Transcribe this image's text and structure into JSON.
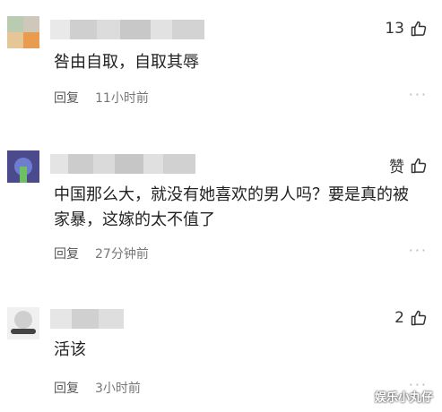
{
  "comments": [
    {
      "text": "咎由自取，自取其辱",
      "reply_label": "回复",
      "time": "11小时前",
      "like": "13",
      "more": "···"
    },
    {
      "text": "中国那么大，就没有她喜欢的男人吗？要是真的被家暴，这嫁的太不值了",
      "reply_label": "回复",
      "time": "27分钟前",
      "like": "赞",
      "more": "···"
    },
    {
      "text": "活该",
      "reply_label": "回复",
      "time": "3小时前",
      "like": "2",
      "more": "···"
    }
  ],
  "watermark": "娱乐小丸仔",
  "colors": {
    "meta": "#777777",
    "text": "#222222"
  },
  "icons": {
    "like": "thumbs-up-icon",
    "more": "more-dots-icon"
  }
}
